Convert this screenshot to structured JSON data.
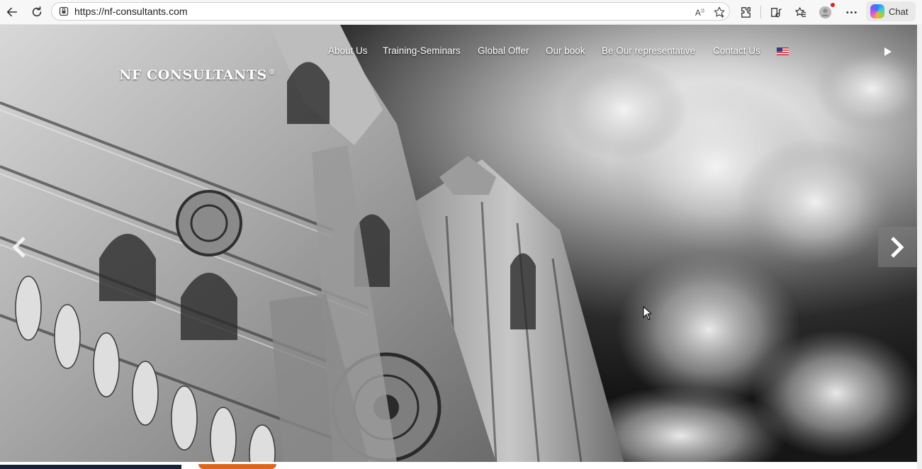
{
  "browser": {
    "url": "https://nf-consultants.com",
    "chat_label": "Chat",
    "icons": [
      "back-icon",
      "refresh-icon",
      "lock-icon",
      "read-aloud-icon",
      "favorite-icon",
      "extensions-icon",
      "media-icon",
      "collections-icon",
      "profile-icon",
      "more-icon",
      "copilot-icon"
    ]
  },
  "site": {
    "logo_text": "NF CONSULTANTS",
    "logo_mark": "®",
    "menu": [
      {
        "label": "About Us"
      },
      {
        "label": "Training-Seminars"
      },
      {
        "label": "Global Offer"
      },
      {
        "label": "Our book"
      },
      {
        "label": "Be Our representative"
      },
      {
        "label": "Contact Us"
      }
    ],
    "language_flag": "us-flag-icon"
  },
  "colors": {
    "browser_bg": "#f7f7f7",
    "arrow_bg": "#808080",
    "bottom_navy": "#16213a",
    "bottom_orange": "#e0651a"
  }
}
